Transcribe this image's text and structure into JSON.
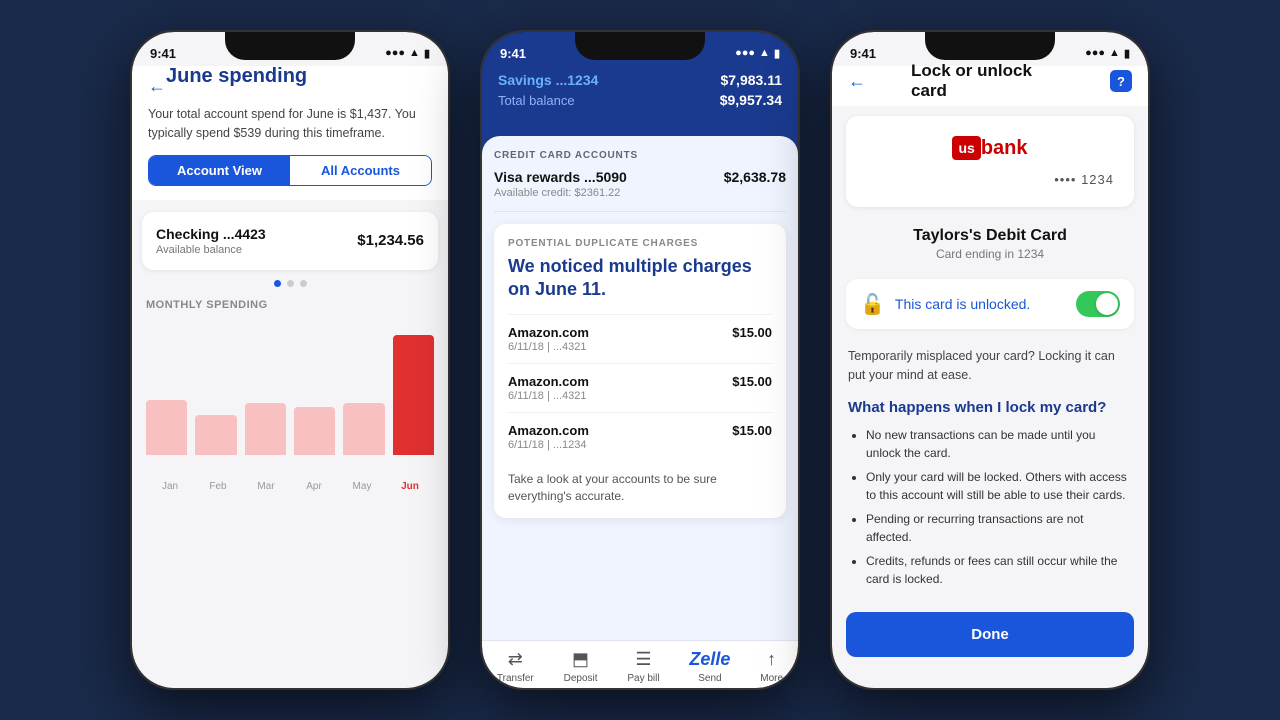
{
  "background": "#1a2a4a",
  "phone1": {
    "status": {
      "time": "9:41",
      "icons": "●●● ▲ ▮"
    },
    "header": {
      "back_icon": "←",
      "title": "June spending",
      "description": "Your total account spend for June is $1,437. You typically spend $539 during this timeframe."
    },
    "tabs": {
      "active": "Account View",
      "inactive": "All Accounts"
    },
    "account_card": {
      "name": "Checking ...4423",
      "sub": "Available balance",
      "amount": "$1,234.56"
    },
    "monthly_title": "MONTHLY SPENDING",
    "chart": {
      "months": [
        "Jan",
        "Feb",
        "Mar",
        "Apr",
        "May",
        "Jun"
      ],
      "heights": [
        55,
        40,
        52,
        48,
        52,
        120
      ],
      "colors": [
        "#f8c0c0",
        "#f8c0c0",
        "#f8c0c0",
        "#f8c0c0",
        "#f8c0c0",
        "#e03030"
      ]
    }
  },
  "phone2": {
    "status": {
      "time": "9:41"
    },
    "header": {
      "account_name": "Savings ...1234",
      "account_amount": "$7,983.11",
      "total_label": "Total balance",
      "total_amount": "$9,957.34"
    },
    "credit_section_title": "CREDIT CARD ACCOUNTS",
    "credit_card": {
      "name": "Visa rewards ...5090",
      "sub": "Available credit: $2361.22",
      "amount": "$2,638.78"
    },
    "alert": {
      "tag": "POTENTIAL DUPLICATE CHARGES",
      "title": "We noticed multiple charges on June 11.",
      "charges": [
        {
          "name": "Amazon.com",
          "sub": "6/11/18 | ...4321",
          "amount": "$15.00"
        },
        {
          "name": "Amazon.com",
          "sub": "6/11/18 | ...4321",
          "amount": "$15.00"
        },
        {
          "name": "Amazon.com",
          "sub": "6/11/18 | ...1234",
          "amount": "$15.00"
        }
      ],
      "footer": "Take a look at your accounts to be sure everything's accurate."
    },
    "tab_bar": [
      {
        "icon": "⇄",
        "label": "Transfer"
      },
      {
        "icon": "⬒",
        "label": "Deposit"
      },
      {
        "icon": "☰",
        "label": "Pay bill"
      },
      {
        "icon": "Z",
        "label": "Send"
      },
      {
        "icon": "↑",
        "label": "More"
      }
    ]
  },
  "phone3": {
    "status": {
      "time": "9:41"
    },
    "header": {
      "back_icon": "←",
      "title": "Lock or unlock card",
      "help_label": "?"
    },
    "card": {
      "logo_us": "us",
      "logo_bank": "bank",
      "card_number": "•••• 1234"
    },
    "card_name": "Taylors's Debit Card",
    "card_sub": "Card ending in 1234",
    "unlock_text": "This card is unlocked.",
    "misplaced_text": "Temporarily misplaced your card? Locking it can put your mind at ease.",
    "what_title": "What happens when I lock my card?",
    "bullets": [
      "No new transactions can be made until you unlock the card.",
      "Only your card will be locked. Others with access to this account will still be able to use their cards.",
      "Pending or recurring transactions are not affected.",
      "Credits, refunds or fees can still occur while the card is locked."
    ],
    "done_label": "Done"
  }
}
